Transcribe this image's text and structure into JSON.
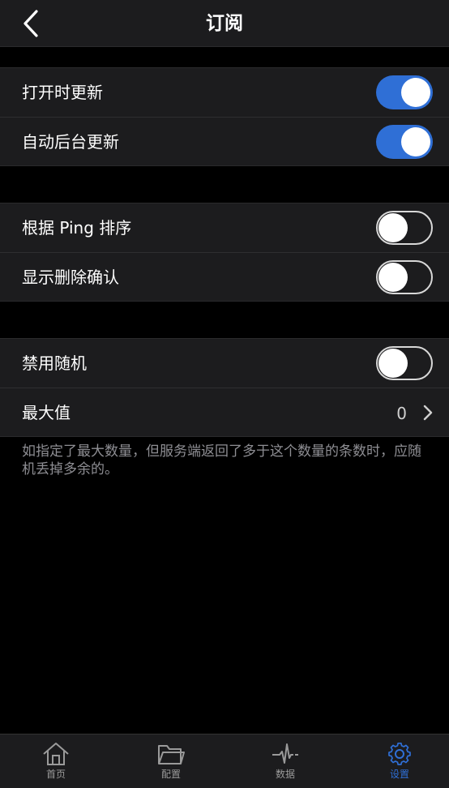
{
  "header": {
    "title": "订阅",
    "back_icon": "chevron-left-icon"
  },
  "groups": [
    {
      "rows": [
        {
          "label": "打开时更新",
          "toggle": "on"
        },
        {
          "label": "自动后台更新",
          "toggle": "on"
        }
      ]
    },
    {
      "rows": [
        {
          "label": "根据 Ping 排序",
          "toggle": "off"
        },
        {
          "label": "显示删除确认",
          "toggle": "off"
        }
      ]
    },
    {
      "rows": [
        {
          "label": "禁用随机",
          "toggle": "off"
        },
        {
          "label": "最大值",
          "value": "0"
        }
      ]
    }
  ],
  "footnote": "如指定了最大数量，但服务端返回了多于这个数量的条数时，应随机丢掉多余的。",
  "tabbar": {
    "items": [
      {
        "label": "首页",
        "icon": "home-icon"
      },
      {
        "label": "配置",
        "icon": "folder-icon"
      },
      {
        "label": "数据",
        "icon": "activity-icon"
      },
      {
        "label": "设置",
        "icon": "gear-icon",
        "active": true
      }
    ]
  },
  "colors": {
    "accent": "#2f6fd6",
    "background": "#000000",
    "cell": "#1c1c1e"
  }
}
